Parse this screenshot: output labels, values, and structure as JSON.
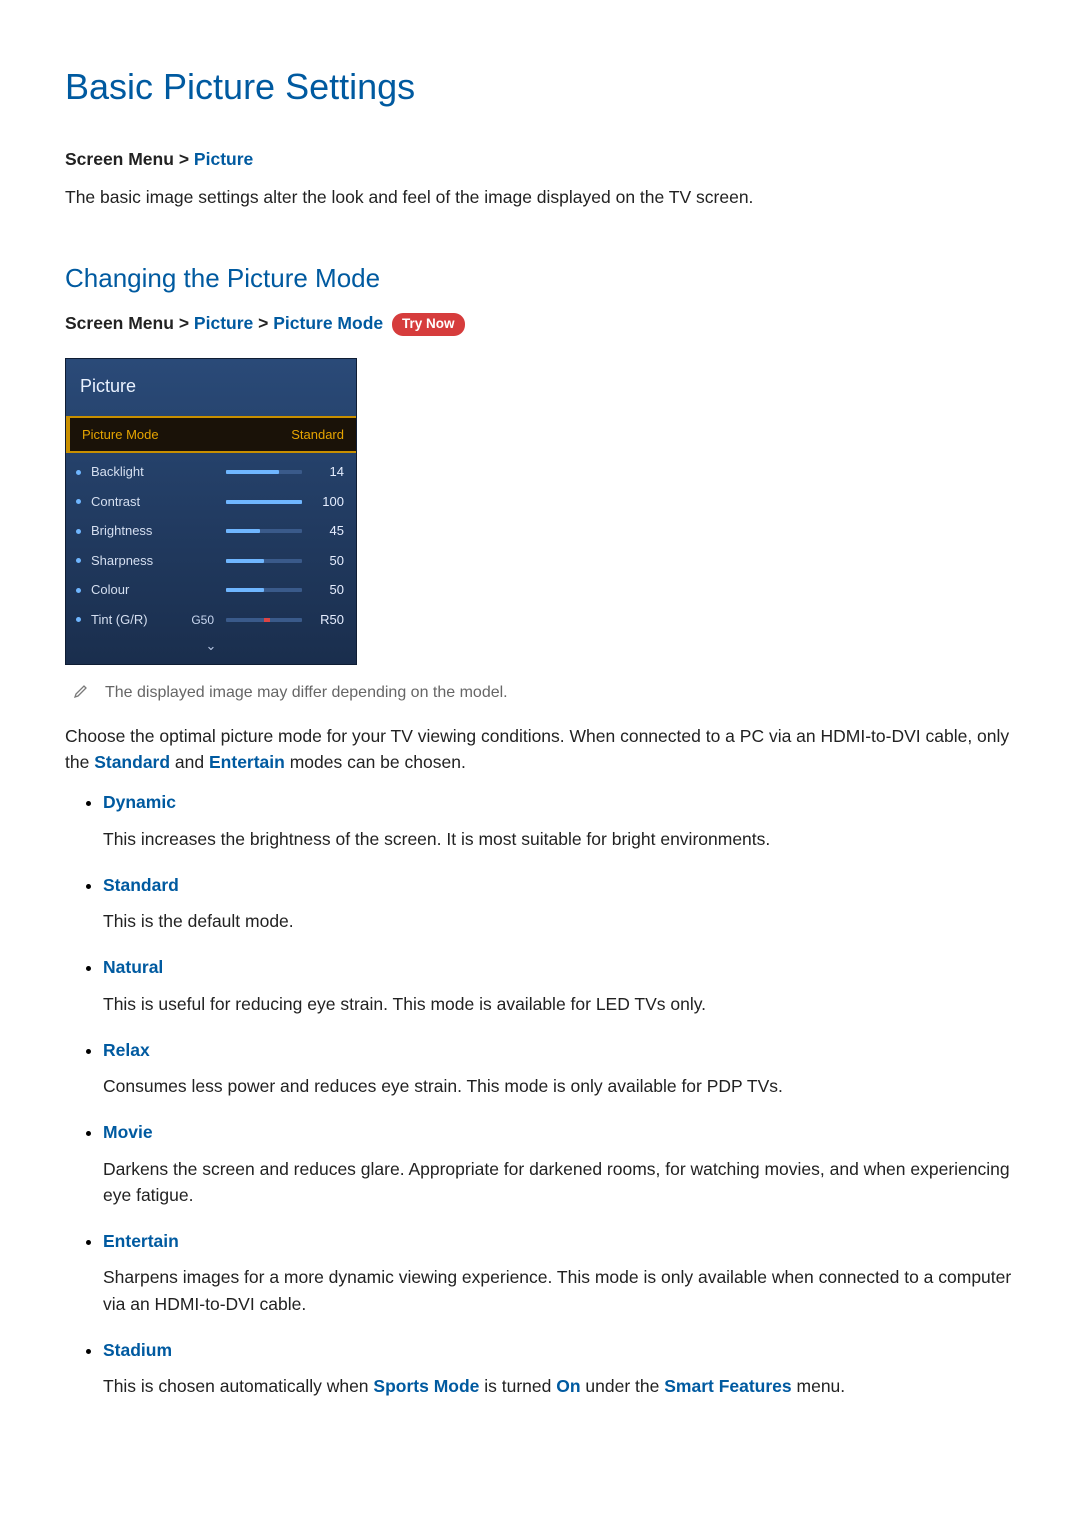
{
  "page": {
    "title": "Basic Picture Settings",
    "crumb1_a": "Screen Menu",
    "crumb1_b": "Picture",
    "intro": "The basic image settings alter the look and feel of the image displayed on the TV screen.",
    "section1_title": "Changing the Picture Mode",
    "crumb2_a": "Screen Menu",
    "crumb2_b": "Picture",
    "crumb2_c": "Picture Mode",
    "try_now": "Try Now",
    "chev": ">",
    "note": "The displayed image may differ depending on the model.",
    "para2_a": "Choose the optimal picture mode for your TV viewing conditions. When connected to a PC via an HDMI-to-DVI cable, only the ",
    "para2_link1": "Standard",
    "para2_mid": " and ",
    "para2_link2": "Entertain",
    "para2_b": " modes can be chosen."
  },
  "osd": {
    "title": "Picture",
    "selected_label": "Picture Mode",
    "selected_value": "Standard",
    "rows": {
      "backlight": {
        "label": "Backlight",
        "value": "14",
        "fill": 70
      },
      "contrast": {
        "label": "Contrast",
        "value": "100",
        "fill": 100
      },
      "brightness": {
        "label": "Brightness",
        "value": "45",
        "fill": 45
      },
      "sharpness": {
        "label": "Sharpness",
        "value": "50",
        "fill": 50
      },
      "colour": {
        "label": "Colour",
        "value": "50",
        "fill": 50
      },
      "tint": {
        "label": "Tint (G/R)",
        "pre": "G50",
        "value": "R50"
      }
    }
  },
  "modes": {
    "dynamic": {
      "name": "Dynamic",
      "desc": "This increases the brightness of the screen. It is most suitable for bright environments."
    },
    "standard": {
      "name": "Standard",
      "desc": "This is the default mode."
    },
    "natural": {
      "name": "Natural",
      "desc": "This is useful for reducing eye strain. This mode is available for LED TVs only."
    },
    "relax": {
      "name": "Relax",
      "desc": "Consumes less power and reduces eye strain. This mode is only available for PDP TVs."
    },
    "movie": {
      "name": "Movie",
      "desc": "Darkens the screen and reduces glare. Appropriate for darkened rooms, for watching movies, and when experiencing eye fatigue."
    },
    "entertain": {
      "name": "Entertain",
      "desc": "Sharpens images for a more dynamic viewing experience. This mode is only available when connected to a computer via an HDMI-to-DVI cable."
    },
    "stadium": {
      "name": "Stadium",
      "desc_a": "This is chosen automatically when ",
      "desc_link1": "Sports Mode",
      "desc_mid1": " is turned ",
      "desc_link2": "On",
      "desc_mid2": " under the ",
      "desc_link3": "Smart Features",
      "desc_b": " menu."
    }
  }
}
